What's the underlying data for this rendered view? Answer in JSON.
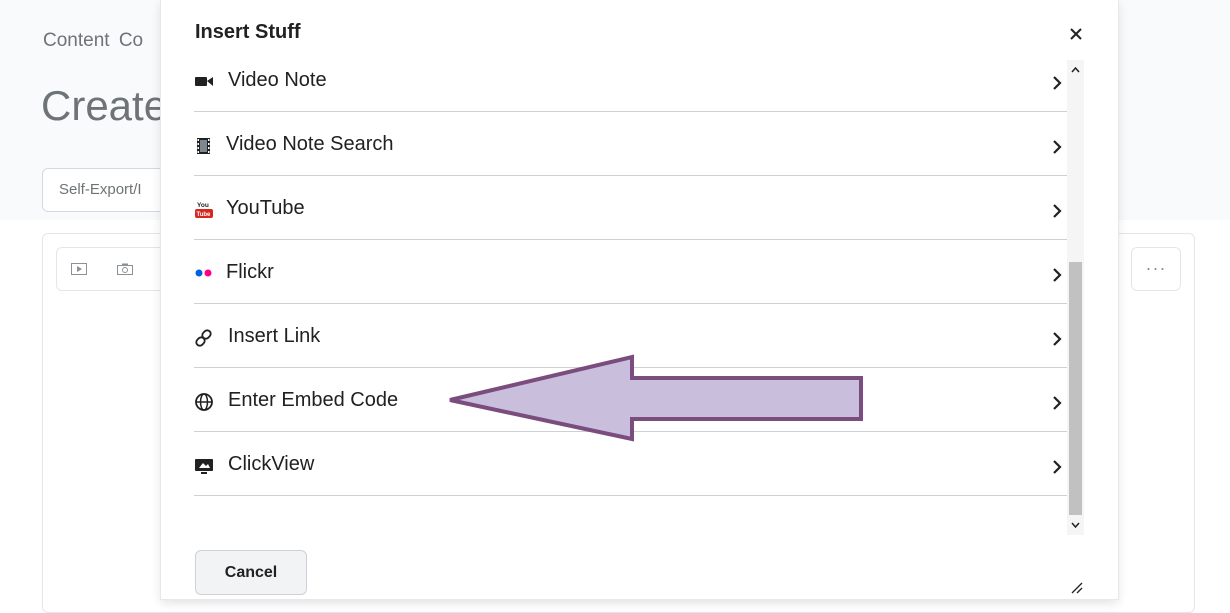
{
  "background": {
    "breadcrumb": [
      "Content",
      "Co"
    ],
    "page_title": "Create",
    "select_value": "Self-Export/I"
  },
  "dialog": {
    "title": "Insert Stuff",
    "close_icon": "close-icon",
    "items": [
      {
        "label": "Video Note",
        "icon": "video-camera-icon"
      },
      {
        "label": "Video Note Search",
        "icon": "film-strip-icon"
      },
      {
        "label": "YouTube",
        "icon": "youtube-icon"
      },
      {
        "label": "Flickr",
        "icon": "flickr-icon"
      },
      {
        "label": "Insert Link",
        "icon": "link-icon"
      },
      {
        "label": "Enter Embed Code",
        "icon": "globe-icon"
      },
      {
        "label": "ClickView",
        "icon": "clickview-icon"
      }
    ],
    "cancel_label": "Cancel"
  },
  "annotation": {
    "arrow_color": "#c9bedc",
    "arrow_stroke": "#7a4d7e"
  }
}
